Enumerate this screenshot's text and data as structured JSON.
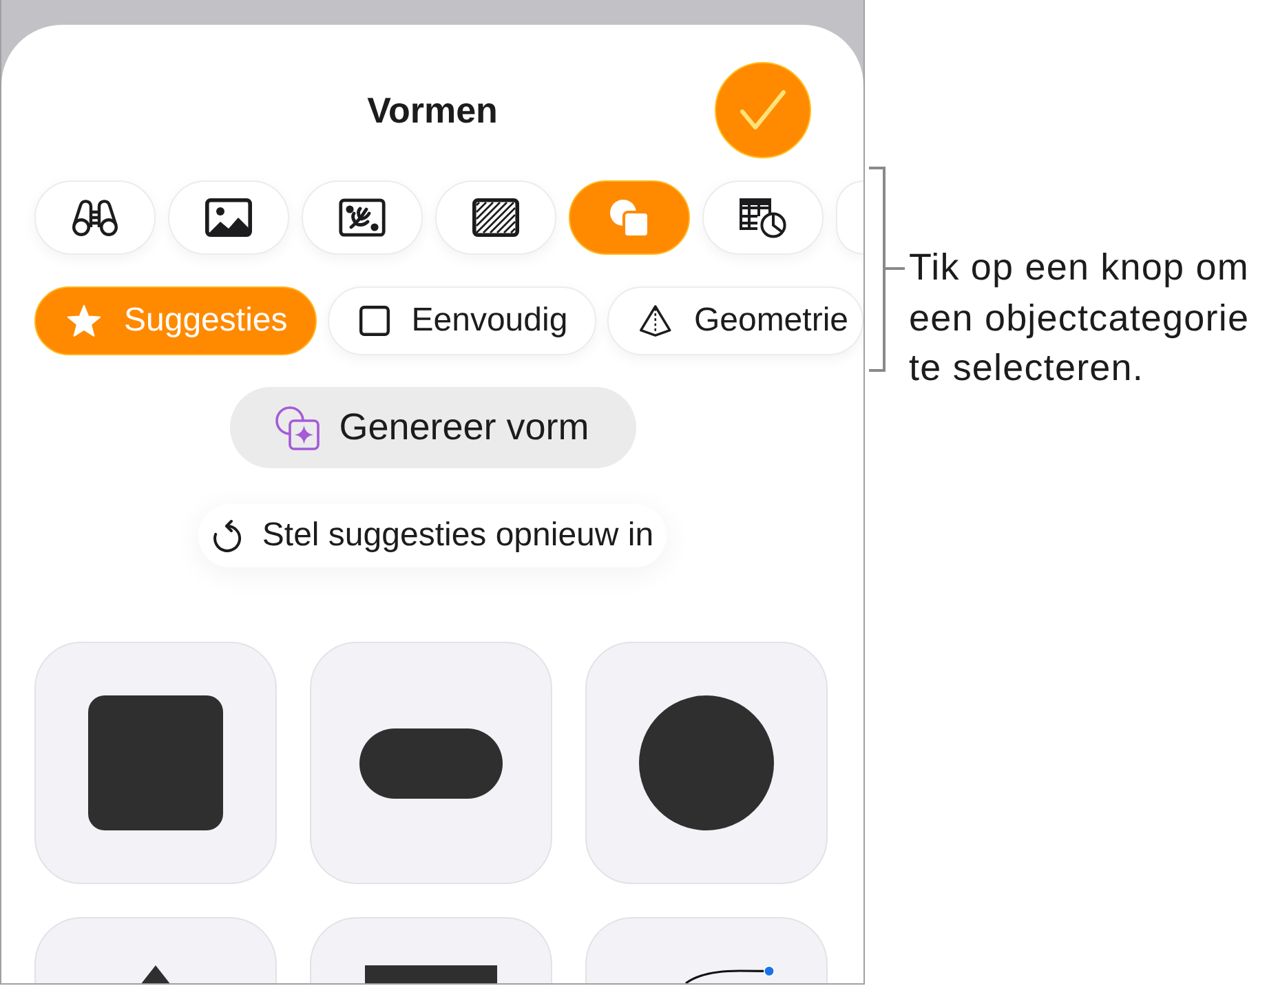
{
  "sheet": {
    "title": "Vormen"
  },
  "categories": [
    {
      "kind": "binoculars",
      "selected": false
    },
    {
      "kind": "photo",
      "selected": false
    },
    {
      "kind": "sketch",
      "selected": false
    },
    {
      "kind": "hatch",
      "selected": false
    },
    {
      "kind": "shapes",
      "selected": true
    },
    {
      "kind": "table",
      "selected": false
    },
    {
      "kind": "partial",
      "selected": false
    }
  ],
  "filters": [
    {
      "label": "Suggesties",
      "kind": "star",
      "selected": true
    },
    {
      "label": "Eenvoudig",
      "kind": "square",
      "selected": false
    },
    {
      "label": "Geometrie",
      "kind": "pyramid",
      "selected": false
    }
  ],
  "generate_button": {
    "label": "Genereer vorm"
  },
  "reset_button": {
    "label": "Stel suggesties opnieuw in"
  },
  "shapes": [
    {
      "kind": "square"
    },
    {
      "kind": "capsule"
    },
    {
      "kind": "circle"
    },
    {
      "kind": "triangle"
    },
    {
      "kind": "rectangle"
    },
    {
      "kind": "curve"
    }
  ],
  "callout": {
    "text": "Tik op een knop om een objectcategorie te selecteren."
  }
}
